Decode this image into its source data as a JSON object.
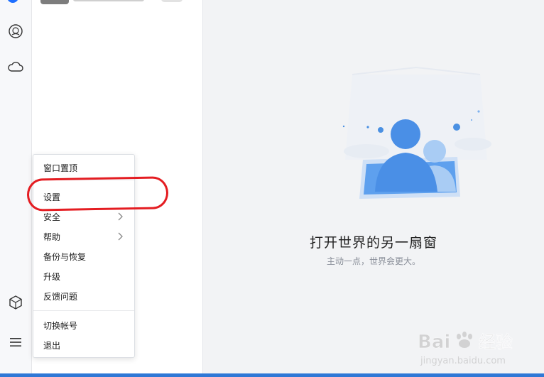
{
  "left_rail": {
    "icons": [
      "app-logo-icon",
      "robot-face-icon",
      "cloud-icon",
      "cube-icon",
      "hamburger-menu-icon"
    ]
  },
  "main": {
    "empty_title": "打开世界的另一扇窗",
    "empty_subtitle": "主动一点，世界会更大。"
  },
  "context_menu": {
    "items": [
      {
        "label": "窗口置顶"
      },
      {
        "label": "设置"
      },
      {
        "label": "安全",
        "has_submenu": true
      },
      {
        "label": "帮助",
        "has_submenu": true
      },
      {
        "label": "备份与恢复"
      },
      {
        "label": "升级"
      },
      {
        "label": "反馈问题"
      },
      {
        "label": "切换帐号"
      },
      {
        "label": "退出"
      }
    ]
  },
  "watermark": {
    "brand": "Bai 经验",
    "url": "jingyan.baidu.com"
  },
  "colors": {
    "accent": "#1e6fff",
    "highlight": "#e41d22",
    "bottom_strip": "#2f78d6"
  }
}
